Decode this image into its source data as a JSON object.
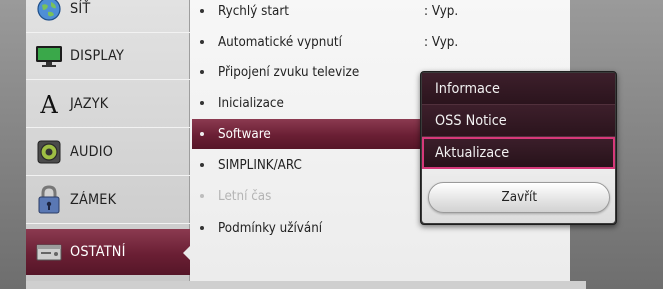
{
  "categories": [
    {
      "label": "SÍŤ",
      "icon": "globe-icon"
    },
    {
      "label": "DISPLAY",
      "icon": "monitor-icon"
    },
    {
      "label": "JAZYK",
      "icon": "language-letter-icon"
    },
    {
      "label": "AUDIO",
      "icon": "speaker-icon"
    },
    {
      "label": "ZÁMEK",
      "icon": "padlock-icon"
    },
    {
      "label": "OSTATNÍ",
      "icon": "other-box-icon",
      "active": true
    }
  ],
  "settings": [
    {
      "name": "Rychlý start",
      "value": ": Vyp."
    },
    {
      "name": "Automatické vypnutí",
      "value": ": Vyp."
    },
    {
      "name": "Připojení zvuku televize",
      "value": ""
    },
    {
      "name": "Inicializace",
      "value": ""
    },
    {
      "name": "Software",
      "value": "",
      "selected": true
    },
    {
      "name": "SIMPLINK/ARC",
      "value": ""
    },
    {
      "name": "Letní čas",
      "value": "",
      "disabled": true
    },
    {
      "name": "Podmínky užívání",
      "value": ""
    }
  ],
  "popup": {
    "items": [
      {
        "label": "Informace"
      },
      {
        "label": "OSS Notice"
      },
      {
        "label": "Aktualizace",
        "focused": true
      }
    ],
    "close_label": "Zavřít"
  },
  "colors": {
    "selection_wine": "#6a1f34",
    "focus_border": "#d6397a"
  }
}
